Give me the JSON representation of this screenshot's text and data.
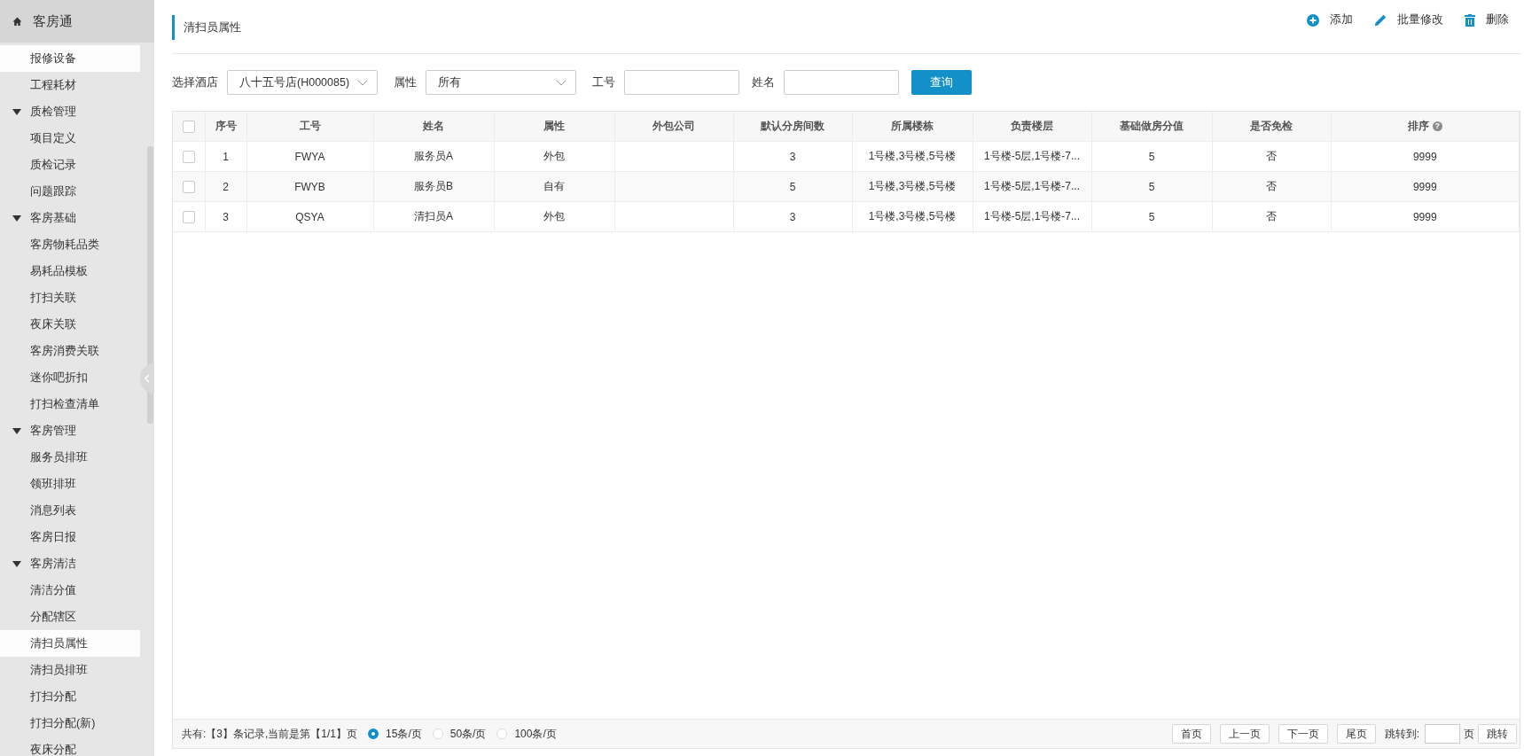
{
  "sidebar": {
    "title": "客房通",
    "items": [
      {
        "kind": "link",
        "label": "报修设备",
        "selected": true
      },
      {
        "kind": "link",
        "label": "工程耗材",
        "selected": false
      },
      {
        "kind": "group",
        "label": "质检管理",
        "expanded": true,
        "children": [
          {
            "kind": "link",
            "label": "项目定义",
            "selected": false
          },
          {
            "kind": "link",
            "label": "质检记录",
            "selected": false
          },
          {
            "kind": "link",
            "label": "问题跟踪",
            "selected": false
          }
        ]
      },
      {
        "kind": "group",
        "label": "客房基础",
        "expanded": true,
        "children": [
          {
            "kind": "link",
            "label": "客房物耗品类",
            "selected": false
          },
          {
            "kind": "link",
            "label": "易耗品模板",
            "selected": false
          },
          {
            "kind": "link",
            "label": "打扫关联",
            "selected": false
          },
          {
            "kind": "link",
            "label": "夜床关联",
            "selected": false
          },
          {
            "kind": "link",
            "label": "客房消费关联",
            "selected": false
          },
          {
            "kind": "link",
            "label": "迷你吧折扣",
            "selected": false
          },
          {
            "kind": "link",
            "label": "打扫检查清单",
            "selected": false
          }
        ]
      },
      {
        "kind": "group",
        "label": "客房管理",
        "expanded": true,
        "children": [
          {
            "kind": "link",
            "label": "服务员排班",
            "selected": false
          },
          {
            "kind": "link",
            "label": "领班排班",
            "selected": false
          },
          {
            "kind": "link",
            "label": "消息列表",
            "selected": false
          },
          {
            "kind": "link",
            "label": "客房日报",
            "selected": false
          }
        ]
      },
      {
        "kind": "group",
        "label": "客房清洁",
        "expanded": true,
        "children": [
          {
            "kind": "link",
            "label": "清洁分值",
            "selected": false
          },
          {
            "kind": "link",
            "label": "分配辖区",
            "selected": false
          },
          {
            "kind": "link",
            "label": "清扫员属性",
            "selected": true
          },
          {
            "kind": "link",
            "label": "清扫员排班",
            "selected": false
          },
          {
            "kind": "link",
            "label": "打扫分配",
            "selected": false
          },
          {
            "kind": "link",
            "label": "打扫分配(新)",
            "selected": false
          },
          {
            "kind": "link",
            "label": "夜床分配",
            "selected": false
          }
        ]
      }
    ]
  },
  "page_title": "清扫员属性",
  "actions": [
    {
      "kind": "add",
      "label": "添加"
    },
    {
      "kind": "edit",
      "label": "批量修改"
    },
    {
      "kind": "delete",
      "label": "删除"
    }
  ],
  "filters": [
    {
      "kind": "select",
      "label": "选择酒店",
      "value": "八十五号店(H000085)"
    },
    {
      "kind": "select",
      "label": "属性",
      "value": "所有"
    },
    {
      "kind": "input",
      "label": "工号"
    },
    {
      "kind": "input",
      "label": "姓名"
    }
  ],
  "search_button": "查询",
  "table": {
    "all_checked": false,
    "columns": [
      {
        "label": "序号"
      },
      {
        "label": "工号"
      },
      {
        "label": "姓名"
      },
      {
        "label": "属性"
      },
      {
        "label": "外包公司"
      },
      {
        "label": "默认分房间数"
      },
      {
        "label": "所属楼栋"
      },
      {
        "label": "负责楼层"
      },
      {
        "label": "基础做房分值"
      },
      {
        "label": "是否免检"
      },
      {
        "label": "排序",
        "help": "?"
      }
    ],
    "rows": [
      {
        "checked": false,
        "cells": [
          "1",
          "FWYA",
          "服务员A",
          "外包",
          "",
          "3",
          "1号楼,3号楼,5号楼",
          "1号楼-5层,1号楼-7...",
          "5",
          "否",
          "9999"
        ]
      },
      {
        "checked": false,
        "cells": [
          "2",
          "FWYB",
          "服务员B",
          "自有",
          "",
          "5",
          "1号楼,3号楼,5号楼",
          "1号楼-5层,1号楼-7...",
          "5",
          "否",
          "9999"
        ]
      },
      {
        "checked": false,
        "cells": [
          "3",
          "QSYA",
          "清扫员A",
          "外包",
          "",
          "3",
          "1号楼,3号楼,5号楼",
          "1号楼-5层,1号楼-7...",
          "5",
          "否",
          "9999"
        ]
      }
    ]
  },
  "footer": {
    "summary": "共有:【3】条记录,当前是第【1/1】页",
    "page_sizes": [
      {
        "label": "15条/页",
        "selected": true
      },
      {
        "label": "50条/页",
        "selected": false
      },
      {
        "label": "100条/页",
        "selected": false
      }
    ],
    "nav_buttons": [
      "首页",
      "上一页",
      "下一页",
      "尾页"
    ],
    "jump_label": "跳转到:",
    "jump_unit": "页",
    "jump_button": "跳转"
  }
}
